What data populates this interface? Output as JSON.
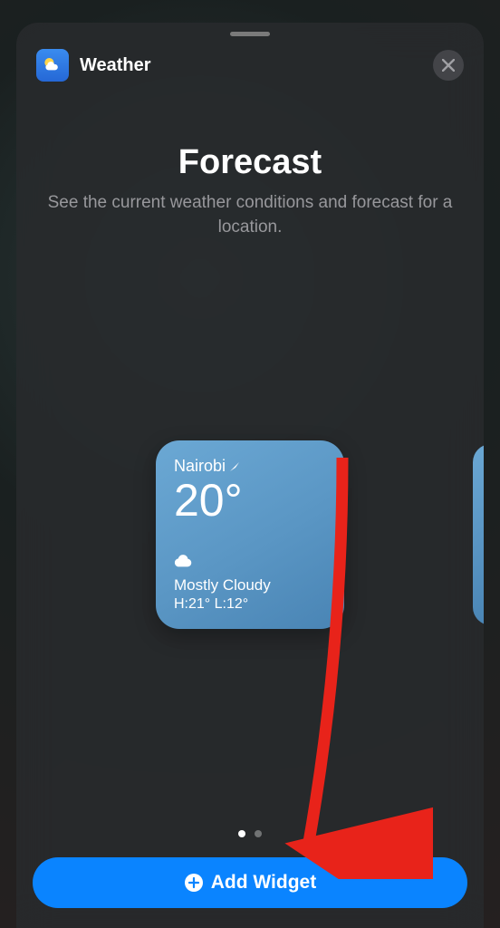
{
  "header": {
    "app_name": "Weather"
  },
  "title_block": {
    "title": "Forecast",
    "subtitle": "See the current weather conditions and forecast for a location."
  },
  "widget": {
    "location": "Nairobi",
    "temperature": "20°",
    "condition": "Mostly Cloudy",
    "high_low": "H:21° L:12°"
  },
  "actions": {
    "add_label": "Add Widget"
  }
}
